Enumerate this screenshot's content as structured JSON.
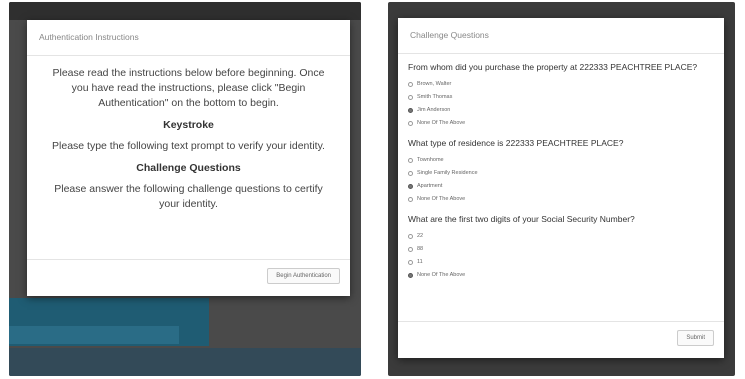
{
  "auth": {
    "title": "Authentication Instructions",
    "intro": "Please read the instructions below before beginning. Once you have read the instructions, please click \"Begin Authentication\" on the bottom to begin.",
    "keystroke_heading": "Keystroke",
    "keystroke_text": "Please type the following text prompt to verify your identity.",
    "challenge_heading": "Challenge Questions",
    "challenge_text": "Please answer the following challenge questions to certify your identity.",
    "begin_label": "Begin Authentication"
  },
  "challenge": {
    "title": "Challenge Questions",
    "questions": [
      {
        "text": "From whom did you purchase the property at 222333 PEACHTREE PLACE?",
        "options": [
          "Brown, Walter",
          "Smith Thomas",
          "Jim Anderson",
          "None Of The Above"
        ],
        "selected": 2
      },
      {
        "text": "What type of residence is 222333 PEACHTREE PLACE?",
        "options": [
          "Townhome",
          "Single Family Residence",
          "Apartment",
          "None Of The Above"
        ],
        "selected": 2
      },
      {
        "text": "What are the first two digits of your Social Security Number?",
        "options": [
          "22",
          "88",
          "11",
          "None Of The Above"
        ],
        "selected": 3
      }
    ],
    "submit_label": "Submit"
  }
}
